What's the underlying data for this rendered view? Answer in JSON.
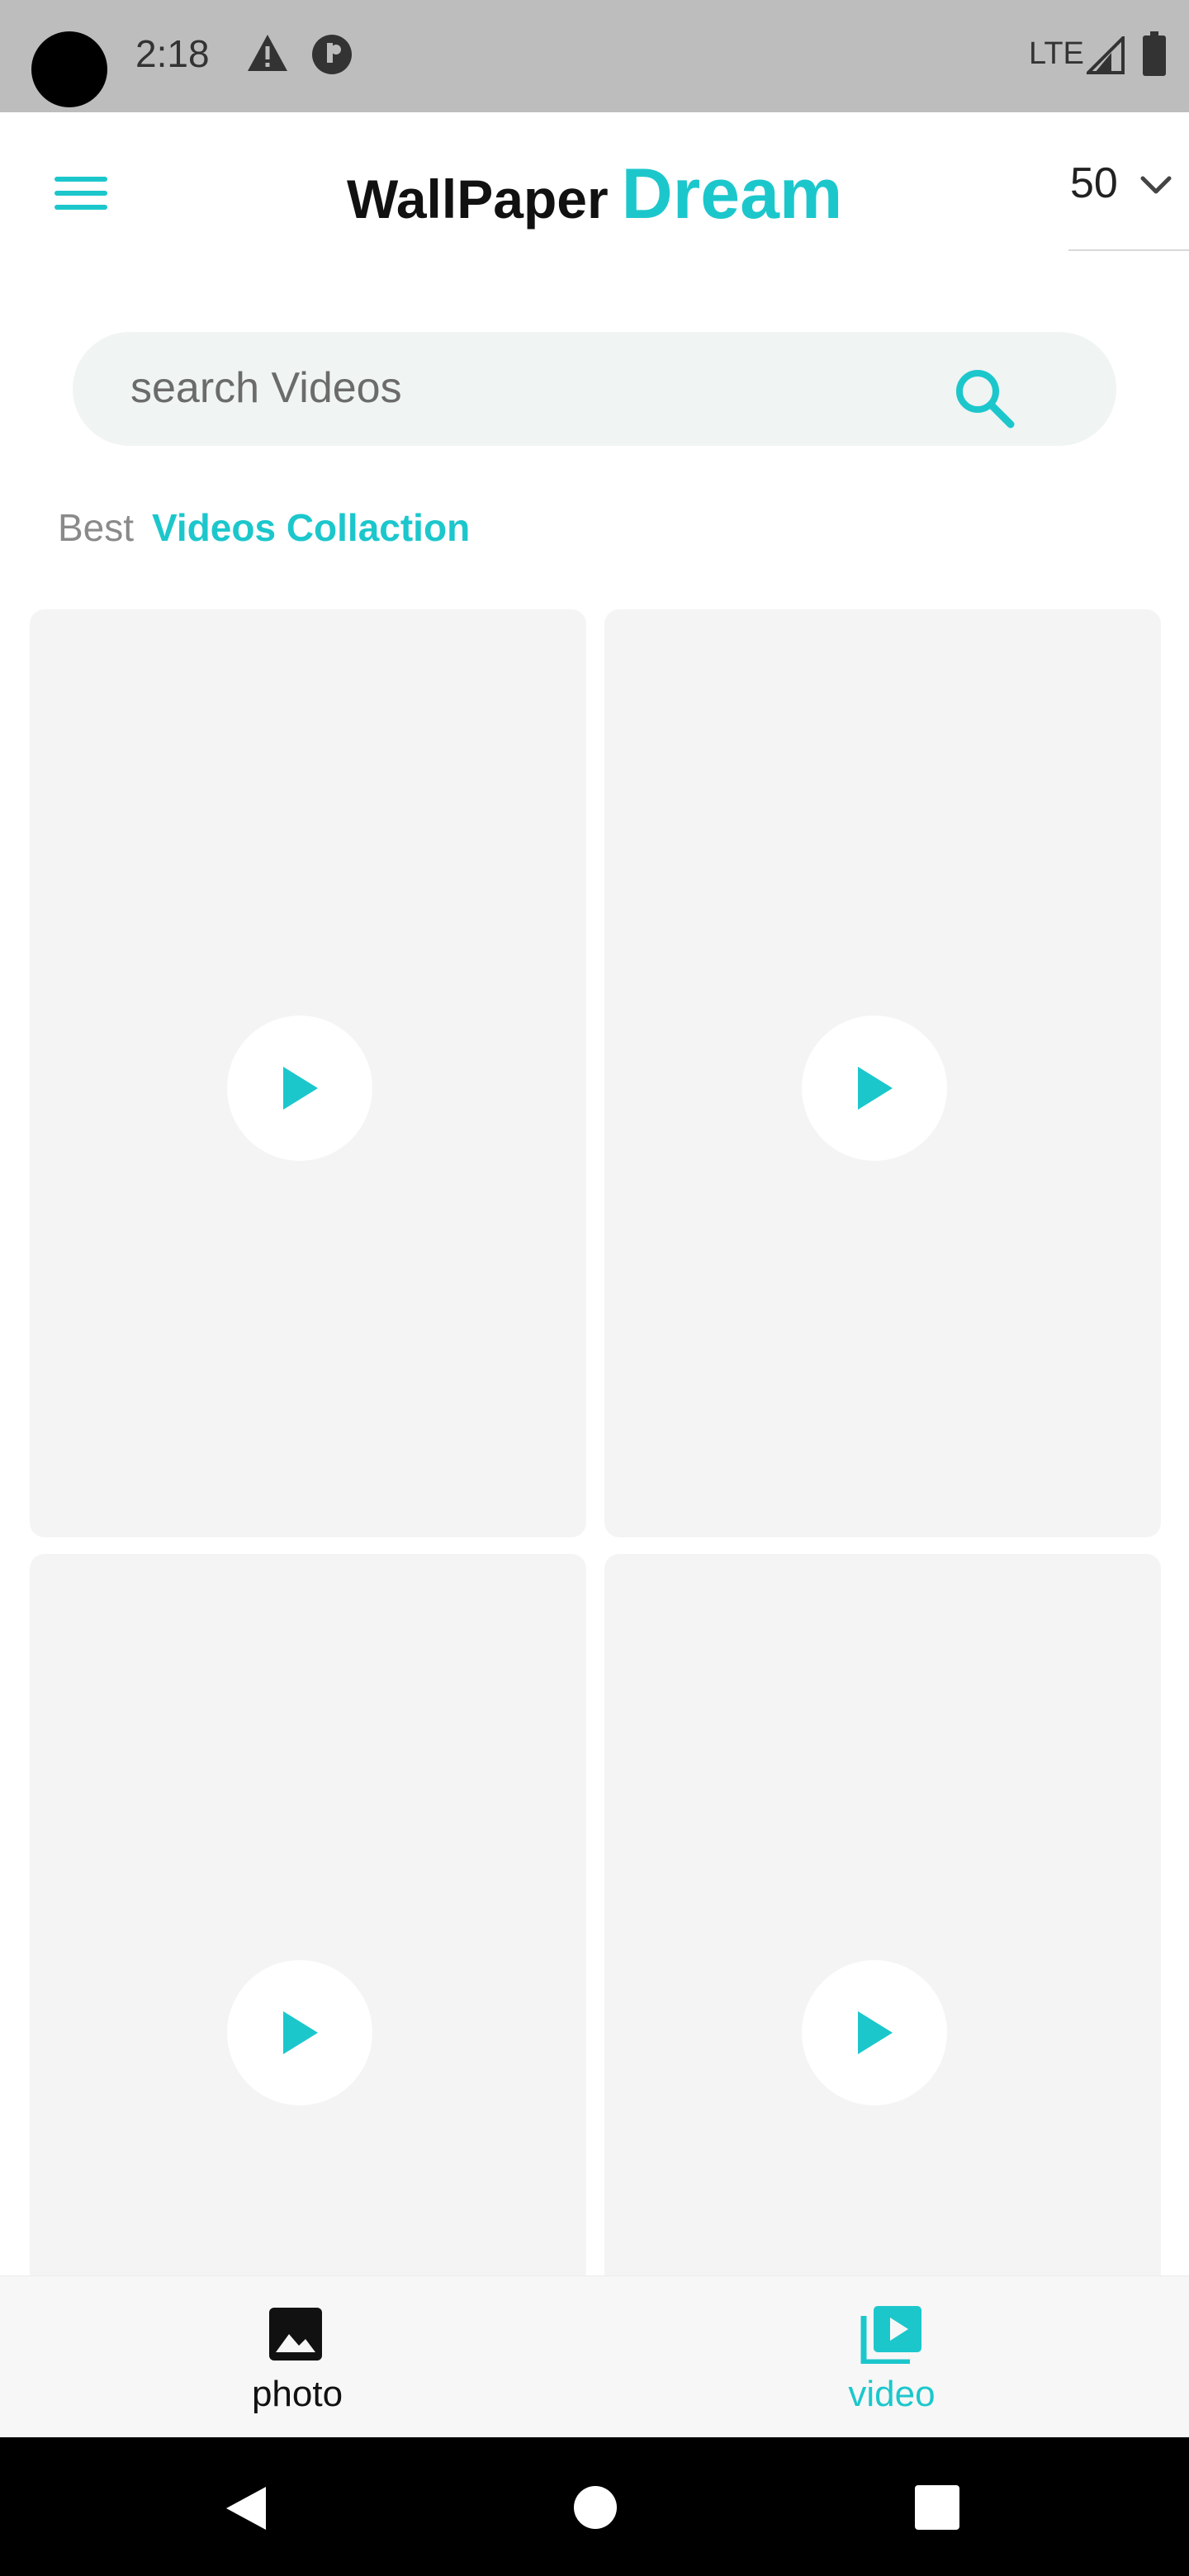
{
  "status_bar": {
    "time": "2:18",
    "network": "LTE",
    "icons": [
      "warning-icon",
      "app-notification-icon",
      "signal-icon",
      "battery-icon"
    ]
  },
  "header": {
    "title_part1": "WallPaper",
    "title_part2": "Dream",
    "count_value": "50",
    "menu_icon": "hamburger-menu-icon"
  },
  "search": {
    "placeholder": "search Videos",
    "value": ""
  },
  "section": {
    "prefix": "Best",
    "title": "Videos Collaction"
  },
  "videos": [
    {
      "id": 1,
      "icon": "play-icon"
    },
    {
      "id": 2,
      "icon": "play-icon"
    },
    {
      "id": 3,
      "icon": "play-icon"
    },
    {
      "id": 4,
      "icon": "play-icon"
    }
  ],
  "bottom_nav": {
    "items": [
      {
        "label": "photo",
        "icon": "image-icon",
        "active": false
      },
      {
        "label": "video",
        "icon": "video-library-icon",
        "active": true
      }
    ]
  },
  "colors": {
    "accent": "#1cc7cc",
    "card_background": "#f5f4f5",
    "search_background": "#f0f4f3",
    "status_bar": "#bdbdbd"
  }
}
